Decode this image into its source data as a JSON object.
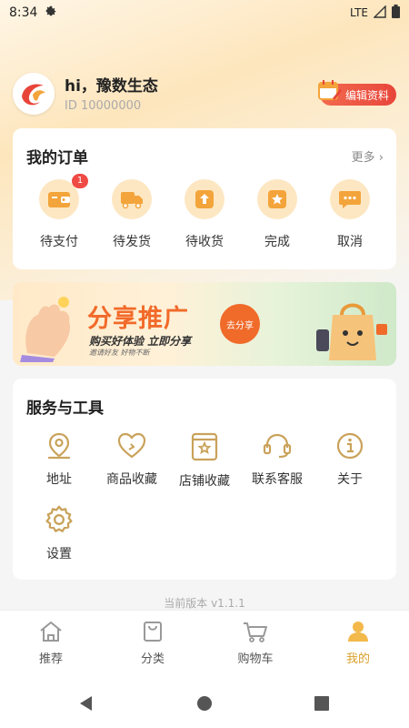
{
  "status_bar": {
    "time": "8:34",
    "network": "LTE"
  },
  "profile": {
    "greeting": "hi，豫数生态",
    "user_id": "ID 10000000",
    "edit_label": "编辑资料"
  },
  "orders": {
    "title": "我的订单",
    "more_label": "更多 ›",
    "items": [
      {
        "label": "待支付",
        "icon": "wallet-icon",
        "badge": "1"
      },
      {
        "label": "待发货",
        "icon": "truck-icon"
      },
      {
        "label": "待收货",
        "icon": "box-icon"
      },
      {
        "label": "完成",
        "icon": "star-box-icon"
      },
      {
        "label": "取消",
        "icon": "chat-icon"
      }
    ]
  },
  "banner": {
    "title": "分享推广",
    "subtitle": "购买好体验 立即分享",
    "note": "邀请好友 好物不断",
    "button_label": "去分享"
  },
  "services": {
    "title": "服务与工具",
    "items": [
      {
        "label": "地址",
        "icon": "location-icon"
      },
      {
        "label": "商品收藏",
        "icon": "heart-icon"
      },
      {
        "label": "店铺收藏",
        "icon": "store-star-icon"
      },
      {
        "label": "联系客服",
        "icon": "headset-icon"
      },
      {
        "label": "关于",
        "icon": "info-icon"
      },
      {
        "label": "设置",
        "icon": "gear-icon"
      }
    ]
  },
  "version_text": "当前版本 v1.1.1",
  "tabbar": {
    "items": [
      {
        "label": "推荐",
        "icon": "home-icon"
      },
      {
        "label": "分类",
        "icon": "bag-icon"
      },
      {
        "label": "购物车",
        "icon": "cart-icon"
      },
      {
        "label": "我的",
        "icon": "user-icon",
        "active": true
      }
    ]
  },
  "colors": {
    "accent": "#d9a12a",
    "badge": "#ef4a44",
    "edit_button": "#e8453a",
    "banner_title": "#f26a2a",
    "icon_fill": "#f3a43a"
  }
}
